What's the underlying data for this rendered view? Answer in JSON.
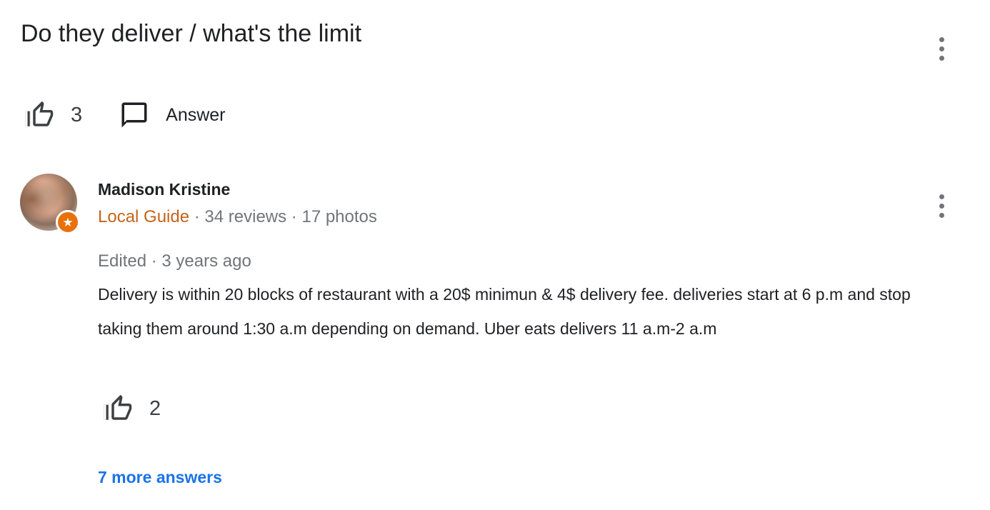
{
  "question": {
    "title": "Do they deliver / what's the limit",
    "like_count": "3",
    "answer_label": "Answer"
  },
  "answer": {
    "author_name": "Madison Kristine",
    "author_badge": "Local Guide",
    "author_stats": " · 34 reviews · 17 photos",
    "edited": "Edited · 3 years ago",
    "text": "Delivery is within 20 blocks of restaurant with a 20$ minimun & 4$ delivery fee. deliveries start at 6 p.m and stop taking them around 1:30 a.m depending on demand. Uber eats delivers 11 a.m-2 a.m",
    "like_count": "2"
  },
  "more_answers_label": "7 more answers",
  "icons": {
    "thumb_up": "thumb-up-icon",
    "answer": "comment-icon",
    "more": "more-vert-icon",
    "badge": "local-guide-star-icon"
  },
  "colors": {
    "text_primary": "#202124",
    "text_secondary": "#70757a",
    "local_guide": "#c5631a",
    "link": "#1a73e8",
    "badge": "#e8710a"
  }
}
